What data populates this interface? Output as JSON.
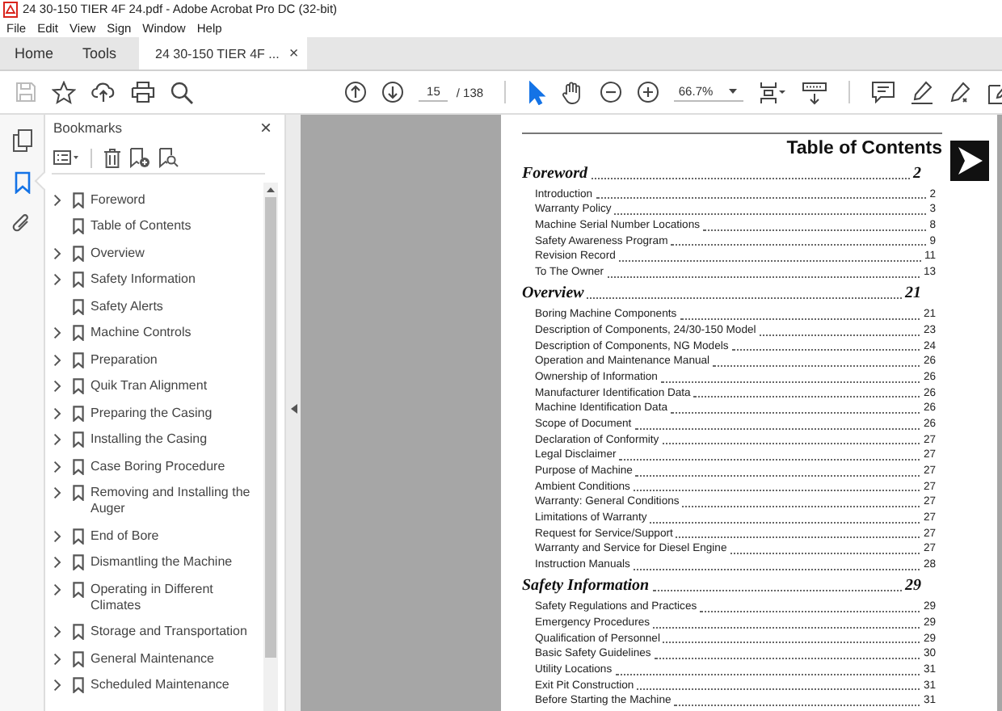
{
  "window": {
    "title": "24 30-150 TIER 4F 24.pdf - Adobe Acrobat Pro DC (32-bit)"
  },
  "menu": [
    "File",
    "Edit",
    "View",
    "Sign",
    "Window",
    "Help"
  ],
  "tabs": [
    {
      "kind": "plain",
      "label": "Home",
      "selected": false
    },
    {
      "kind": "plain",
      "label": "Tools",
      "selected": false
    },
    {
      "kind": "document",
      "label": "24 30-150 TIER 4F ...",
      "close": "×",
      "selected": true
    }
  ],
  "toolbar": {
    "save_disabled": true,
    "page": "15",
    "page_total": "/ 138",
    "tools": [
      {
        "kind": "select",
        "selected": true
      },
      {
        "kind": "hand",
        "selected": false
      }
    ],
    "zoom": "66.7%"
  },
  "side_rail": [
    {
      "kind": "pages",
      "selected": false
    },
    {
      "kind": "bookmarks",
      "selected": true
    },
    {
      "kind": "attachments",
      "selected": false
    }
  ],
  "bookmarks": {
    "title": "Bookmarks",
    "close": "×",
    "items": [
      {
        "label": "Foreword",
        "expandable": true
      },
      {
        "label": "Table of Contents",
        "expandable": false
      },
      {
        "label": "Overview",
        "expandable": true
      },
      {
        "label": "Safety Information",
        "expandable": true
      },
      {
        "label": "Safety Alerts",
        "expandable": false
      },
      {
        "label": "Machine Controls",
        "expandable": true
      },
      {
        "label": "Preparation",
        "expandable": true
      },
      {
        "label": "Quik Tran Alignment",
        "expandable": true
      },
      {
        "label": "Preparing the Casing",
        "expandable": true
      },
      {
        "label": "Installing the Casing",
        "expandable": true
      },
      {
        "label": "Case Boring Procedure",
        "expandable": true
      },
      {
        "label": "Removing and Installing the Auger",
        "expandable": true
      },
      {
        "label": "End of Bore",
        "expandable": true
      },
      {
        "label": "Dismantling the Machine",
        "expandable": true
      },
      {
        "label": "Operating in Different Climates",
        "expandable": true
      },
      {
        "label": "Storage and Transportation",
        "expandable": true
      },
      {
        "label": "General Maintenance",
        "expandable": true
      },
      {
        "label": "Scheduled Maintenance",
        "expandable": true
      }
    ]
  },
  "document": {
    "heading": "Table of Contents",
    "sections": [
      {
        "title": "Foreword",
        "page": "2",
        "entries": [
          {
            "title": "Introduction",
            "page": "2"
          },
          {
            "title": "Warranty Policy",
            "page": "3"
          },
          {
            "title": "Machine Serial Number Locations",
            "page": "8"
          },
          {
            "title": "Safety Awareness Program",
            "page": "9"
          },
          {
            "title": "Revision Record",
            "page": "11"
          },
          {
            "title": "To The Owner",
            "page": "13"
          }
        ]
      },
      {
        "title": "Overview",
        "page": "21",
        "entries": [
          {
            "title": "Boring Machine Components",
            "page": "21"
          },
          {
            "title": "Description of Components, 24/30-150 Model",
            "page": "23"
          },
          {
            "title": "Description of Components, NG Models",
            "page": "24"
          },
          {
            "title": "Operation and Maintenance Manual",
            "page": "26"
          },
          {
            "title": "Ownership of Information",
            "page": "26"
          },
          {
            "title": "Manufacturer Identification Data",
            "page": "26"
          },
          {
            "title": "Machine Identification Data",
            "page": "26"
          },
          {
            "title": "Scope of Document",
            "page": "26"
          },
          {
            "title": "Declaration of Conformity",
            "page": "27"
          },
          {
            "title": "Legal Disclaimer",
            "page": "27"
          },
          {
            "title": "Purpose of Machine",
            "page": "27"
          },
          {
            "title": "Ambient Conditions",
            "page": "27"
          },
          {
            "title": "Warranty: General Conditions",
            "page": "27"
          },
          {
            "title": "Limitations of Warranty",
            "page": "27"
          },
          {
            "title": "Request for Service/Support",
            "page": "27"
          },
          {
            "title": "Warranty and Service for Diesel Engine",
            "page": "27"
          },
          {
            "title": "Instruction Manuals",
            "page": "28"
          }
        ]
      },
      {
        "title": "Safety Information",
        "page": "29",
        "entries": [
          {
            "title": "Safety Regulations and Practices",
            "page": "29"
          },
          {
            "title": "Emergency Procedures",
            "page": "29"
          },
          {
            "title": "Qualification of Personnel",
            "page": "29"
          },
          {
            "title": "Basic Safety Guidelines",
            "page": "30"
          },
          {
            "title": "Utility Locations",
            "page": "31"
          },
          {
            "title": "Exit Pit Construction",
            "page": "31"
          },
          {
            "title": "Before Starting the Machine",
            "page": "31"
          }
        ]
      }
    ]
  }
}
